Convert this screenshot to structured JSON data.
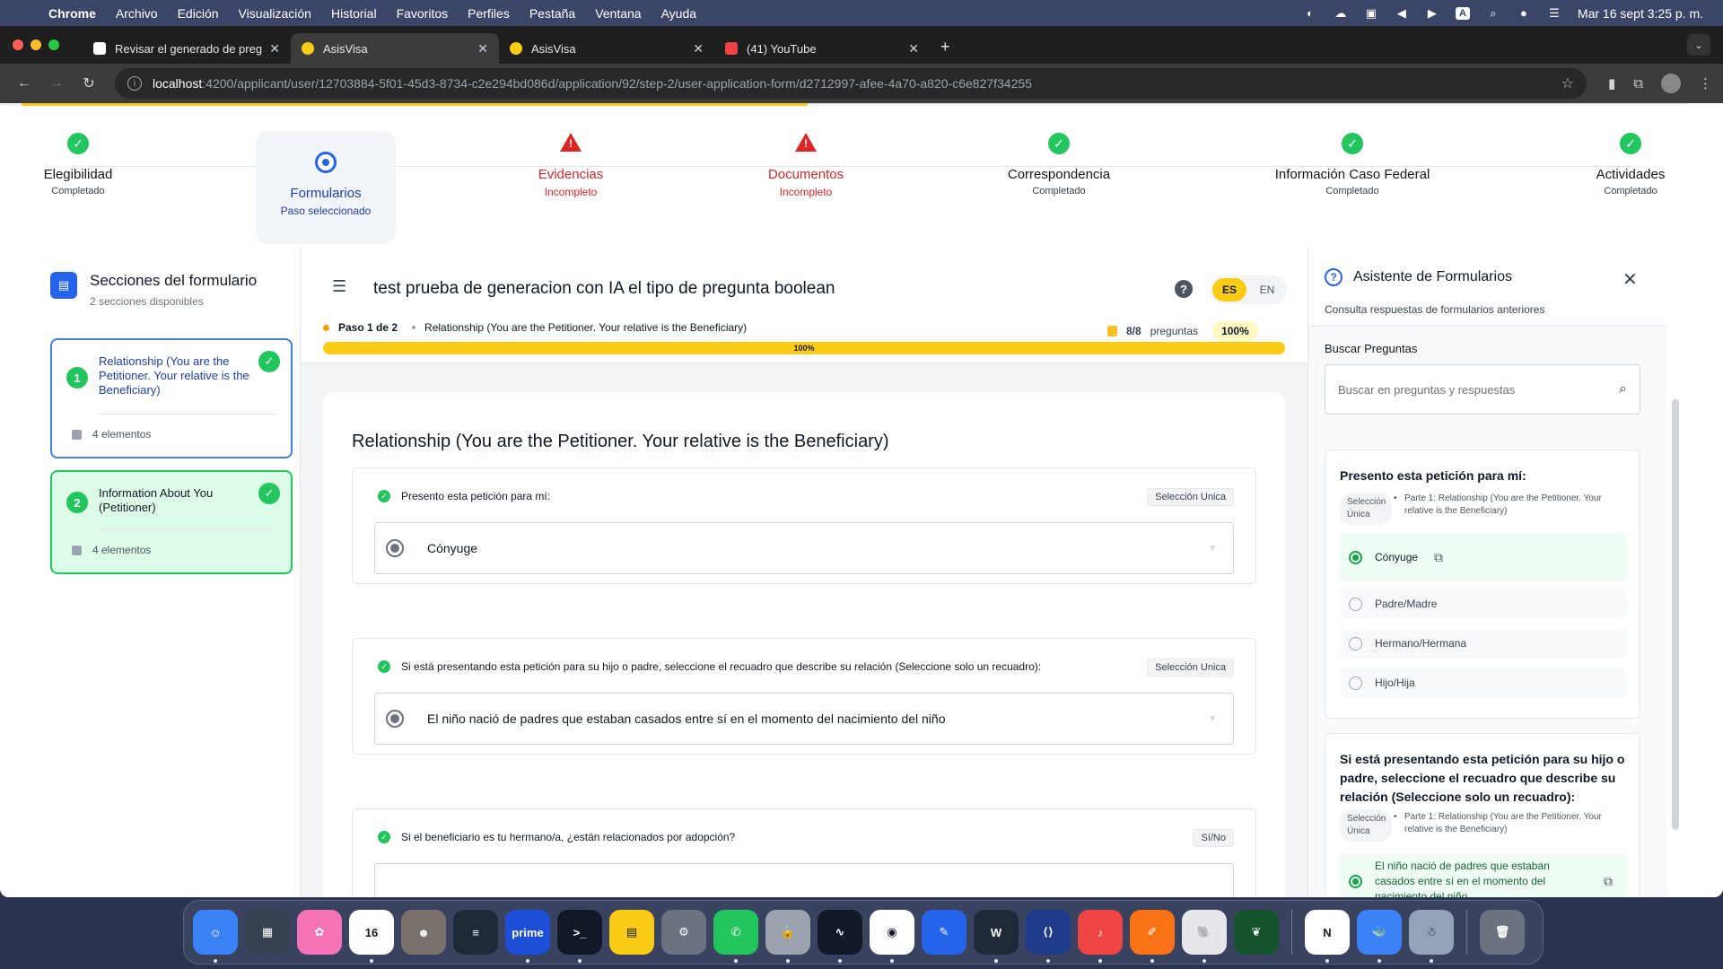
{
  "menubar": {
    "app": "Chrome",
    "items": [
      "Archivo",
      "Edición",
      "Visualización",
      "Historial",
      "Favoritos",
      "Perfiles",
      "Pestaña",
      "Ventana",
      "Ayuda"
    ],
    "tray_letter": "A",
    "clock": "Mar 16 sept  3:25 p. m."
  },
  "tabs": [
    {
      "title": "Revisar el generado de preguntas",
      "favicon_color": "#ffffff"
    },
    {
      "title": "AsisVisa",
      "favicon_color": "#facc15"
    },
    {
      "title": "AsisVisa",
      "favicon_color": "#facc15"
    },
    {
      "title": "(41) YouTube",
      "favicon_color": "#ef4444"
    }
  ],
  "address": {
    "host": "localhost",
    "path": ":4200/applicant/user/12703884-5f01-45d3-8734-c2e294bd086d/application/92/step-2/user-application-form/d2712997-afee-4a70-a820-c6e827f34255"
  },
  "stepper": {
    "steps": [
      {
        "name": "Elegibilidad",
        "status": "Completado",
        "state": "done"
      },
      {
        "name": "Formularios",
        "status": "Paso seleccionado",
        "state": "current"
      },
      {
        "name": "Evidencias",
        "status": "Incompleto",
        "state": "error"
      },
      {
        "name": "Documentos",
        "status": "Incompleto",
        "state": "error"
      },
      {
        "name": "Correspondencia",
        "status": "Completado",
        "state": "done"
      },
      {
        "name": "Información Caso Federal",
        "status": "Completado",
        "state": "done"
      },
      {
        "name": "Actividades",
        "status": "Completado",
        "state": "done"
      }
    ]
  },
  "sidebar": {
    "title": "Secciones del formulario",
    "subtitle": "2 secciones disponibles",
    "sections": [
      {
        "number": "1",
        "label": "Relationship (You are the Petitioner. Your relative is the Beneficiary)",
        "elements": "4 elementos"
      },
      {
        "number": "2",
        "label": "Information About You (Petitioner)",
        "elements": "4 elementos"
      }
    ]
  },
  "form": {
    "title": "test prueba de generacion con IA el tipo de pregunta boolean",
    "lang_es": "ES",
    "lang_en": "EN",
    "step_label": "Paso 1 de 2",
    "section_name": "Relationship (You are the Petitioner. Your relative is the Beneficiary)",
    "question_count": "8/8",
    "question_word": "preguntas",
    "percent": "100%",
    "progress_value": 1.0,
    "progress_label": "100%",
    "card_title": "Relationship (You are the Petitioner. Your relative is the Beneficiary)",
    "questions": [
      {
        "text": "Presento esta petición para mí:",
        "type": "Selección Unica",
        "value": "Cónyuge"
      },
      {
        "text": "Si está presentando esta petición para su hijo o padre, seleccione el recuadro que describe su relación (Seleccione solo un recuadro):",
        "type": "Selección Unica",
        "value": "El niño nació de padres que estaban casados entre sí en el momento del nacimiento del niño"
      },
      {
        "text": "Si el beneficiario es tu hermano/a, ¿están relacionados por adopción?",
        "type": "Sí/No",
        "value": ""
      }
    ]
  },
  "assistant": {
    "title": "Asistente de Formularios",
    "subtitle": "Consulta respuestas de formularios anteriores",
    "search_label": "Buscar Preguntas",
    "search_placeholder": "Buscar en preguntas y respuestas",
    "cards": [
      {
        "question": "Presento esta petición para mí:",
        "chip": "Selección Única",
        "part": "Parte 1: Relationship (You are the Petitioner. Your relative is the Beneficiary)",
        "options": [
          "Cónyuge",
          "Padre/Madre",
          "Hermano/Hermana",
          "Hijo/Hija"
        ]
      },
      {
        "question": "Si está presentando esta petición para su hijo o padre, seleccione el recuadro que describe su relación (Seleccione solo un recuadro):",
        "chip": "Selección Única",
        "part": "Parte 1: Relationship (You are the Petitioner. Your relative is the Beneficiary)",
        "options": [
          "El niño nació de padres que estaban casados entre sí en el momento del nacimiento del niño"
        ]
      }
    ]
  },
  "dock": {
    "apps": [
      {
        "name": "finder",
        "color": "#3b82f6",
        "glyph": "☺"
      },
      {
        "name": "launchpad",
        "color": "#374151",
        "glyph": "▦"
      },
      {
        "name": "photos",
        "color": "#f472b6",
        "glyph": "✿"
      },
      {
        "name": "calendar",
        "color": "#ffffff",
        "glyph": "16"
      },
      {
        "name": "contacts",
        "color": "#78716c",
        "glyph": "☻"
      },
      {
        "name": "reminders",
        "color": "#1f2937",
        "glyph": "≡"
      },
      {
        "name": "prime-video",
        "color": "#1d4ed8",
        "glyph": "prime"
      },
      {
        "name": "terminal",
        "color": "#111827",
        "glyph": ">_"
      },
      {
        "name": "notes",
        "color": "#facc15",
        "glyph": "▤"
      },
      {
        "name": "system-settings",
        "color": "#6b7280",
        "glyph": "⚙"
      },
      {
        "name": "whatsapp",
        "color": "#22c55e",
        "glyph": "✆"
      },
      {
        "name": "passwords",
        "color": "#9ca3af",
        "glyph": "🔒"
      },
      {
        "name": "activity-monitor",
        "color": "#111827",
        "glyph": "∿"
      },
      {
        "name": "chrome",
        "color": "#ffffff",
        "glyph": "◉"
      },
      {
        "name": "xcode-tool",
        "color": "#2563eb",
        "glyph": "✎"
      },
      {
        "name": "sublime",
        "color": "#1f2937",
        "glyph": "W"
      },
      {
        "name": "vscode",
        "color": "#1e3a8a",
        "glyph": "⟨⟩"
      },
      {
        "name": "music",
        "color": "#ef4444",
        "glyph": "♪"
      },
      {
        "name": "postman",
        "color": "#f97316",
        "glyph": "✐"
      },
      {
        "name": "tableplus",
        "color": "#e5e7eb",
        "glyph": "🐘"
      },
      {
        "name": "mongodb-compass",
        "color": "#14532d",
        "glyph": "❦"
      },
      {
        "name": "notion",
        "color": "#ffffff",
        "glyph": "N"
      },
      {
        "name": "docker",
        "color": "#3b82f6",
        "glyph": "🐳"
      },
      {
        "name": "robot-app",
        "color": "#94a3b8",
        "glyph": "☃"
      },
      {
        "name": "trash",
        "color": "#6b7280",
        "glyph": "🗑"
      }
    ]
  }
}
